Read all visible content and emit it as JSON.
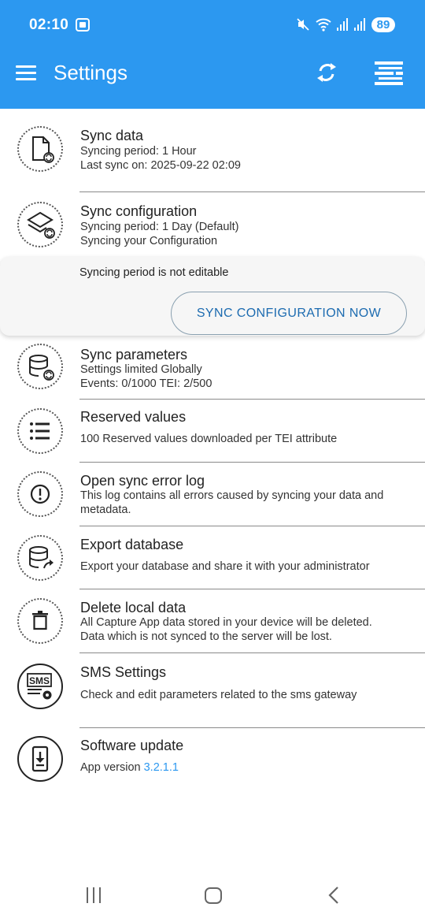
{
  "status_bar": {
    "time": "02:10",
    "battery": "89"
  },
  "toolbar": {
    "title": "Settings",
    "icons": [
      "menu-icon",
      "sync-icon",
      "filter-icon"
    ]
  },
  "items": [
    {
      "title": "Sync data",
      "lines": [
        "Syncing period: 1 Hour",
        "Last sync on: 2025-09-22 02:09"
      ],
      "icon": "file-sync-icon"
    },
    {
      "title": "Sync configuration",
      "lines": [
        "Syncing period: 1 Day (Default)",
        "Syncing your Configuration"
      ],
      "icon": "layers-sync-icon"
    },
    {
      "title": "Sync parameters",
      "lines": [
        "Settings limited Globally",
        "Events: 0/1000 TEI: 2/500"
      ],
      "icon": "database-sync-icon"
    },
    {
      "title": "Reserved values",
      "lines": [
        "100 Reserved values downloaded per TEI attribute"
      ],
      "icon": "list-icon"
    },
    {
      "title": "Open sync error log",
      "lines": [
        "This log contains all errors caused by syncing your data and metadata."
      ],
      "icon": "error-icon"
    },
    {
      "title": "Export database",
      "lines": [
        "Export your database and share it with your administrator"
      ],
      "icon": "database-export-icon"
    },
    {
      "title": "Delete local data",
      "lines": [
        "All Capture App data stored in your device will be deleted.",
        "Data which is not synced to the server will be lost."
      ],
      "icon": "trash-icon"
    },
    {
      "title": "SMS Settings",
      "lines": [
        "Check and edit parameters related to the sms gateway"
      ],
      "icon": "sms-settings-icon"
    },
    {
      "title": "Software update",
      "version_label": "App version",
      "version_value": "3.2.1.1",
      "icon": "phone-download-icon"
    }
  ],
  "config_card": {
    "note": "Syncing period is not editable",
    "button": "SYNC CONFIGURATION NOW"
  },
  "colors": {
    "primary": "#2c98f0",
    "button_text": "#1c6bb0"
  }
}
